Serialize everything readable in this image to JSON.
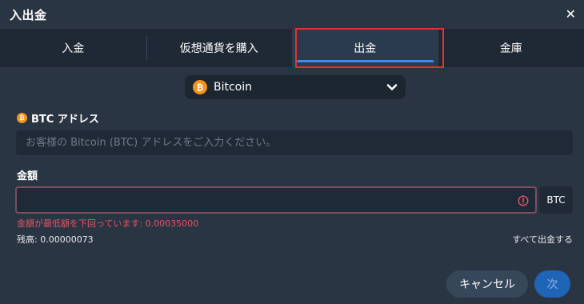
{
  "dialog": {
    "title": "入出金",
    "close_glyph": "✕"
  },
  "tabs": [
    {
      "label": "入金",
      "active": false
    },
    {
      "label": "仮想通貨を購入",
      "active": false
    },
    {
      "label": "出金",
      "active": true
    },
    {
      "label": "金庫",
      "active": false
    }
  ],
  "coin_select": {
    "value": "Bitcoin",
    "icon": "bitcoin-icon",
    "icon_glyph": "₿"
  },
  "address": {
    "label": "BTC アドレス",
    "placeholder": "お客様の Bitcoin (BTC) アドレスをご入力ください。",
    "value": ""
  },
  "amount": {
    "label": "金額",
    "value": "",
    "unit": "BTC",
    "error": "金額が最低額を下回っています: 0.00035000"
  },
  "balance": {
    "text": "残高: 0.00000073"
  },
  "withdraw_all_label": "すべて出金する",
  "footer": {
    "cancel_label": "キャンセル",
    "next_label": "次"
  },
  "colors": {
    "background": "#2a3543",
    "tab_bar": "#1e2935",
    "active_tab_underline": "#3a8ef0",
    "highlight_outline": "#e4322b",
    "bitcoin_orange": "#f7931a",
    "error": "#e05565",
    "next_button": "#1e64b7"
  }
}
